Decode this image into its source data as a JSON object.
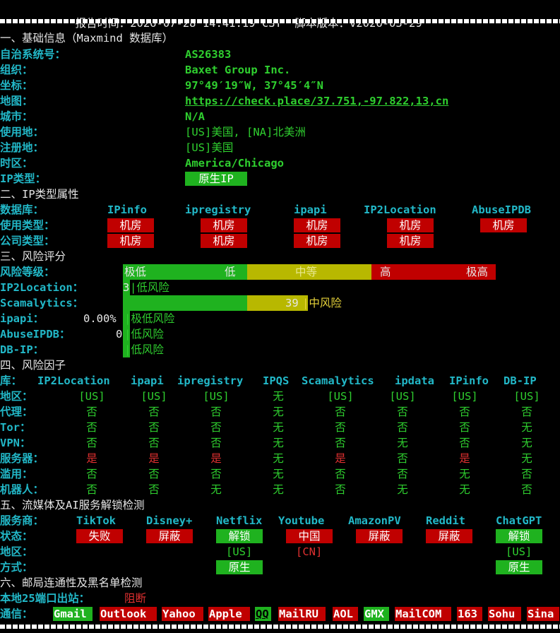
{
  "header": {
    "time_label": "报告时间：",
    "time_value": "2026-07-28 14:41:19 CST",
    "version_label": "脚本版本：",
    "version_value": "v2026-03-29"
  },
  "basic": {
    "section_title": "一、基础信息（Maxmind 数据库）",
    "asn_label": "自治系统号：",
    "asn": "AS26383",
    "org_label": "组织：",
    "org": "Baxet Group Inc.",
    "coord_label": "坐标：",
    "coord": "97°49′19″W, 37°45′4″N",
    "map_label": "地图：",
    "map_url": "https://check.place/37.751,-97.822,13,cn",
    "city_label": "城市：",
    "city": "N/A",
    "use_label": "使用地：",
    "use_value": "[US]美国, [NA]北美洲",
    "reg_label": "注册地：",
    "reg_value": "[US]美国",
    "tz_label": "时区：",
    "tz": "America/Chicago",
    "iptype_label": "IP类型：",
    "iptype": "原生IP"
  },
  "iptype": {
    "section_title": "二、IP类型属性",
    "db_label": "数据库：",
    "dbs": [
      "IPinfo",
      "ipregistry",
      "ipapi",
      "IP2Location",
      "AbuseIPDB"
    ],
    "usage_label": "使用类型：",
    "usage": [
      "机房",
      "机房",
      "机房",
      "机房",
      "机房"
    ],
    "company_label": "公司类型：",
    "company": [
      "机房",
      "机房",
      "机房",
      "机房"
    ]
  },
  "risk": {
    "section_title": "三、风险评分",
    "level_label": "风险等级：",
    "scale": [
      "极低",
      "低",
      "中等",
      "高",
      "极高"
    ],
    "colors": {
      "green": "#1fb21f",
      "yellow": "#b8b800",
      "red": "#c00000"
    },
    "rows": [
      {
        "label": "IP2Location：",
        "score": "3",
        "verdict": "低风险"
      },
      {
        "label": "Scamalytics：",
        "score": "39",
        "verdict": "中风险"
      },
      {
        "label": "ipapi：",
        "score": "0.00%",
        "verdict": "极低风险"
      },
      {
        "label": "AbuseIPDB：",
        "score": "0",
        "verdict": "低风险"
      },
      {
        "label": "DB-IP：",
        "score": "",
        "verdict": "低风险"
      }
    ]
  },
  "factors": {
    "section_title": "四、风险因子",
    "db_label": "库：",
    "dbs": [
      "IP2Location",
      "ipapi",
      "ipregistry",
      "IPQS",
      "Scamalytics",
      "ipdata",
      "IPinfo",
      "DB-IP"
    ],
    "rows": [
      {
        "label": "地区：",
        "values": [
          "[US]",
          "[US]",
          "[US]",
          "无",
          "[US]",
          "[US]",
          "[US]",
          "[US]"
        ]
      },
      {
        "label": "代理：",
        "values": [
          "否",
          "否",
          "否",
          "无",
          "否",
          "否",
          "否",
          "否"
        ]
      },
      {
        "label": "Tor：",
        "values": [
          "否",
          "否",
          "否",
          "无",
          "否",
          "否",
          "否",
          "无"
        ]
      },
      {
        "label": "VPN：",
        "values": [
          "否",
          "否",
          "否",
          "无",
          "否",
          "无",
          "否",
          "无"
        ]
      },
      {
        "label": "服务器：",
        "values": [
          "是",
          "是",
          "是",
          "无",
          "是",
          "否",
          "是",
          "无"
        ]
      },
      {
        "label": "滥用：",
        "values": [
          "否",
          "否",
          "否",
          "无",
          "否",
          "否",
          "无",
          "否"
        ]
      },
      {
        "label": "机器人：",
        "values": [
          "否",
          "否",
          "无",
          "无",
          "否",
          "无",
          "无",
          "否"
        ]
      }
    ]
  },
  "streaming": {
    "section_title": "五、流媒体及AI服务解锁检测",
    "service_label": "服务商：",
    "services": [
      "TikTok",
      "Disney+",
      "Netflix",
      "Youtube",
      "AmazonPV",
      "Reddit",
      "ChatGPT"
    ],
    "status_label": "状态：",
    "status": [
      "失败",
      "屏蔽",
      "解锁",
      "中国",
      "屏蔽",
      "屏蔽",
      "解锁"
    ],
    "region_label": "地区：",
    "regions": [
      "",
      "",
      "[US]",
      "[CN]",
      "",
      "",
      "[US]"
    ],
    "method_label": "方式：",
    "methods": [
      "",
      "",
      "原生",
      "",
      "",
      "",
      "原生"
    ]
  },
  "mail": {
    "section_title": "六、邮局连通性及黑名单检测",
    "port25_label": "本地25端口出站：",
    "port25_value": "阻断",
    "comm_label": "通信：",
    "providers": [
      "Gmail",
      "Outlook",
      "Yahoo",
      "Apple",
      "QQ",
      "MailRU",
      "AOL",
      "GMX",
      "MailCOM",
      "163",
      "Sohu",
      "Sina"
    ],
    "provider_ok": [
      true,
      false,
      false,
      false,
      true,
      false,
      false,
      true,
      false,
      false,
      false,
      false
    ]
  }
}
